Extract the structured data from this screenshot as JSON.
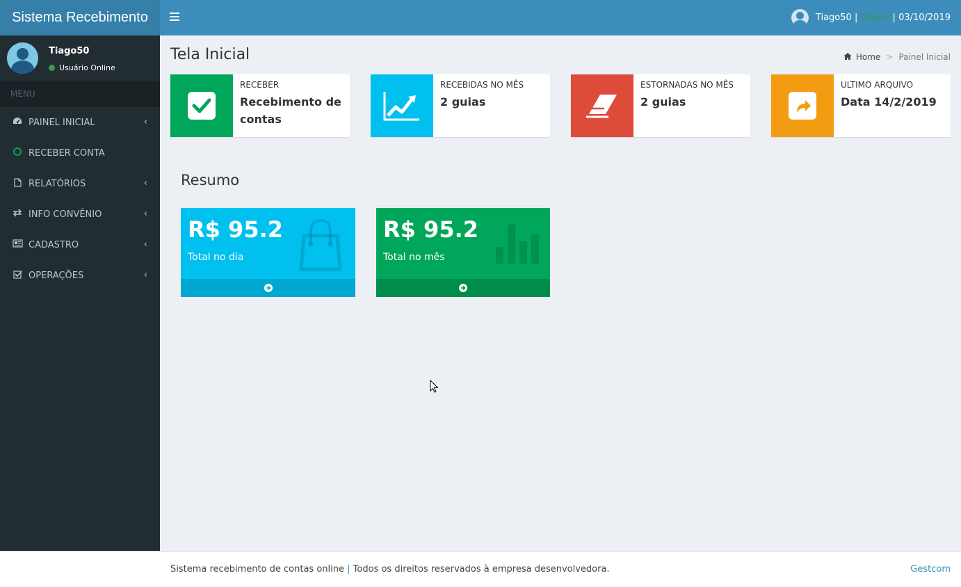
{
  "app": {
    "title": "Sistema Recebimento"
  },
  "navbar": {
    "username": "Tiago50",
    "sep1": " | ",
    "status": "Online",
    "sep2": " | ",
    "date": "03/10/2019"
  },
  "user_panel": {
    "name": "Tiago50",
    "status": "Usuário Online"
  },
  "sidebar": {
    "header": "MENU",
    "items": [
      {
        "label": "PAINEL INICIAL",
        "icon": "dashboard-icon"
      },
      {
        "label": "RECEBER CONTA",
        "icon": "circle-icon"
      },
      {
        "label": "RELATÓRIOS",
        "icon": "file-icon"
      },
      {
        "label": "INFO CONVÊNIO",
        "icon": "exchange-icon"
      },
      {
        "label": "CADASTRO",
        "icon": "newspaper-icon"
      },
      {
        "label": "OPERAÇÕES",
        "icon": "check-square-icon"
      }
    ]
  },
  "content": {
    "title": "Tela Inicial",
    "breadcrumb": {
      "home": "Home",
      "sep": ">",
      "current": "Painel Inicial"
    }
  },
  "info_boxes": [
    {
      "label": "RECEBER",
      "value": "Recebimento de contas",
      "color": "#00a65a",
      "icon": "check-square-icon"
    },
    {
      "label": "RECEBIDAS NO MÊS",
      "value": "2 guias",
      "color": "#00c0ef",
      "icon": "line-chart-icon"
    },
    {
      "label": "ESTORNADAS NO MÊS",
      "value": "2 guias",
      "color": "#dd4b39",
      "icon": "eraser-icon"
    },
    {
      "label": "ULTIMO ARQUIVO",
      "value": "Data 14/2/2019",
      "color": "#f39c12",
      "icon": "share-square-icon"
    }
  ],
  "resumo": {
    "title": "Resumo",
    "boxes": [
      {
        "value": "R$ 95.2",
        "label": "Total no dia",
        "color": "#00c0ef",
        "footer_color": "#00a7d0",
        "icon": "shopping-bag-icon"
      },
      {
        "value": "R$ 95.2",
        "label": "Total no mês",
        "color": "#00a65a",
        "footer_color": "#008d4c",
        "icon": "bar-chart-icon"
      }
    ]
  },
  "footer": {
    "text": "Sistema recebimento de contas online",
    "sep": "|",
    "text2": "Todos os direitos reservados à empresa desenvolvedora.",
    "link": "Gestcom"
  }
}
